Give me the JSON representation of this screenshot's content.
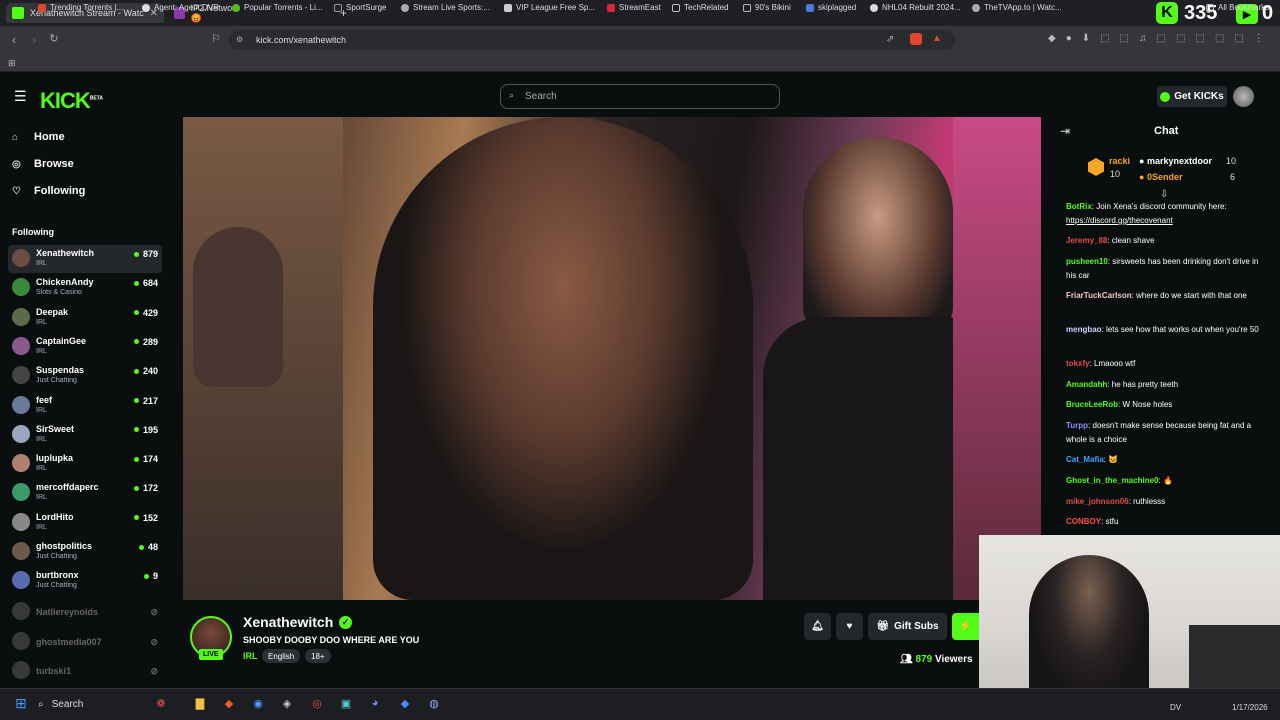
{
  "browser": {
    "tabs": [
      {
        "label": "Xenathewitch Stream - Watc",
        "active": true
      },
      {
        "label": "IP2.Network 😡",
        "active": false
      }
    ],
    "url": "kick.com/xenathewitch",
    "bookmarks": [
      "Trending Torrents |...",
      "Agent: Agent DVR",
      "Popular Torrents - Li...",
      "SportSurge",
      "Stream Live Sports:...",
      "VIP League Free Sp...",
      "StreamEast",
      "TechRelated",
      "90's Bikini",
      "skiplagged",
      "NHL04 Rebuilt 2024...",
      "TheTVApp.to | Watc..."
    ],
    "all_bookmarks": "All Bookmarks",
    "overlay_counter": "335",
    "overlay_counter_suffix": "0"
  },
  "kick": {
    "logo": "KICK",
    "logo_sup": "BETA",
    "search_placeholder": "Search",
    "get_kicks": "Get KICKs",
    "nav": [
      "Home",
      "Browse",
      "Following"
    ],
    "following_header": "Following",
    "channels": [
      {
        "name": "Xenathewitch",
        "cat": "IRL",
        "viewers": "879",
        "live": true,
        "color": "#6b4d44"
      },
      {
        "name": "ChickenAndy",
        "cat": "Slots & Casino",
        "viewers": "684",
        "live": true,
        "color": "#3a8a3a"
      },
      {
        "name": "Deepak",
        "cat": "IRL",
        "viewers": "429",
        "live": true,
        "color": "#5a6a4a"
      },
      {
        "name": "CaptainGee",
        "cat": "IRL",
        "viewers": "289",
        "live": true,
        "color": "#8a5a8a"
      },
      {
        "name": "Suspendas",
        "cat": "Just Chatting",
        "viewers": "240",
        "live": true,
        "color": "#444"
      },
      {
        "name": "feef",
        "cat": "IRL",
        "viewers": "217",
        "live": true,
        "color": "#6a7a9a"
      },
      {
        "name": "SirSweet",
        "cat": "IRL",
        "viewers": "195",
        "live": true,
        "color": "#9aa6c0"
      },
      {
        "name": "Iuplupka",
        "cat": "IRL",
        "viewers": "174",
        "live": true,
        "color": "#b08070"
      },
      {
        "name": "mercoffdaperc",
        "cat": "IRL",
        "viewers": "172",
        "live": true,
        "color": "#3a9a6a"
      },
      {
        "name": "LordHito",
        "cat": "IRL",
        "viewers": "152",
        "live": true,
        "color": "#888"
      },
      {
        "name": "ghostpolitics",
        "cat": "Just Chatting",
        "viewers": "48",
        "live": true,
        "color": "#6a5a4a"
      },
      {
        "name": "burtbronx",
        "cat": "Just Chatting",
        "viewers": "9",
        "live": true,
        "color": "#5a6ab0"
      },
      {
        "name": "Natliereynolds",
        "cat": "",
        "viewers": "",
        "live": false,
        "color": "#777"
      },
      {
        "name": "ghostmedia007",
        "cat": "",
        "viewers": "",
        "live": false,
        "color": "#777"
      },
      {
        "name": "turbski1",
        "cat": "",
        "viewers": "",
        "live": false,
        "color": "#777"
      }
    ],
    "stream": {
      "streamer": "Xenathewitch",
      "live_label": "LIVE",
      "title": "SHOOBY DOOBY DOO WHERE ARE YOU",
      "category": "IRL",
      "tags": [
        "English",
        "18+"
      ],
      "gift_subs": "Gift Subs",
      "viewers": "879",
      "viewers_label": "Viewers"
    },
    "chat": {
      "title": "Chat",
      "leaderboard": [
        {
          "name": "racki",
          "count": "10",
          "color": "#f5a623"
        },
        {
          "name": "markynextdoor",
          "count": "10",
          "color": "#ffffff"
        },
        {
          "name": "0Sender",
          "count": "6",
          "color": "#f5a623"
        }
      ],
      "messages": [
        {
          "user": "BotRix",
          "color": "#53fc18",
          "text": "Join Xena's discord community here: ",
          "link": "https://discord.gg/thecovenant"
        },
        {
          "user": "Jeremy_88",
          "color": "#e04b4b",
          "text": "clean shave"
        },
        {
          "user": "pusheen10",
          "color": "#53fc18",
          "text": "sirsweets has been drinking don't drive in his car"
        },
        {
          "user": "FriarTuckCarlson",
          "color": "#f5c6c6",
          "text": "where do we start with that one"
        },
        {
          "user": "mengbao",
          "color": "#d0d0ff",
          "text": "lets see how that works out when you're 50"
        },
        {
          "user": "tokxfy",
          "color": "#e04b4b",
          "text": "Lmaooo wtf"
        },
        {
          "user": "Amandahh",
          "color": "#53fc18",
          "text": "he has pretty teeth"
        },
        {
          "user": "BruceLeeRob",
          "color": "#53fc18",
          "text": "W Nose holes"
        },
        {
          "user": "Turpp",
          "color": "#8a8aff",
          "text": "doesn't make sense because being fat and a whole is a choice"
        },
        {
          "user": "Cat_Mafia",
          "color": "#4aa0ff",
          "text": "🐱"
        },
        {
          "user": "Ghost_in_the_machine0",
          "color": "#53fc18",
          "text": "🔥"
        },
        {
          "user": "mike_johnson06",
          "color": "#e04b4b",
          "text": "ruthlesss"
        },
        {
          "user": "CONBOY",
          "color": "#ff4a4a",
          "text": "stfu"
        }
      ]
    }
  },
  "taskbar": {
    "search": "Search",
    "tray_label": "DV",
    "date": "1/17/2026"
  }
}
